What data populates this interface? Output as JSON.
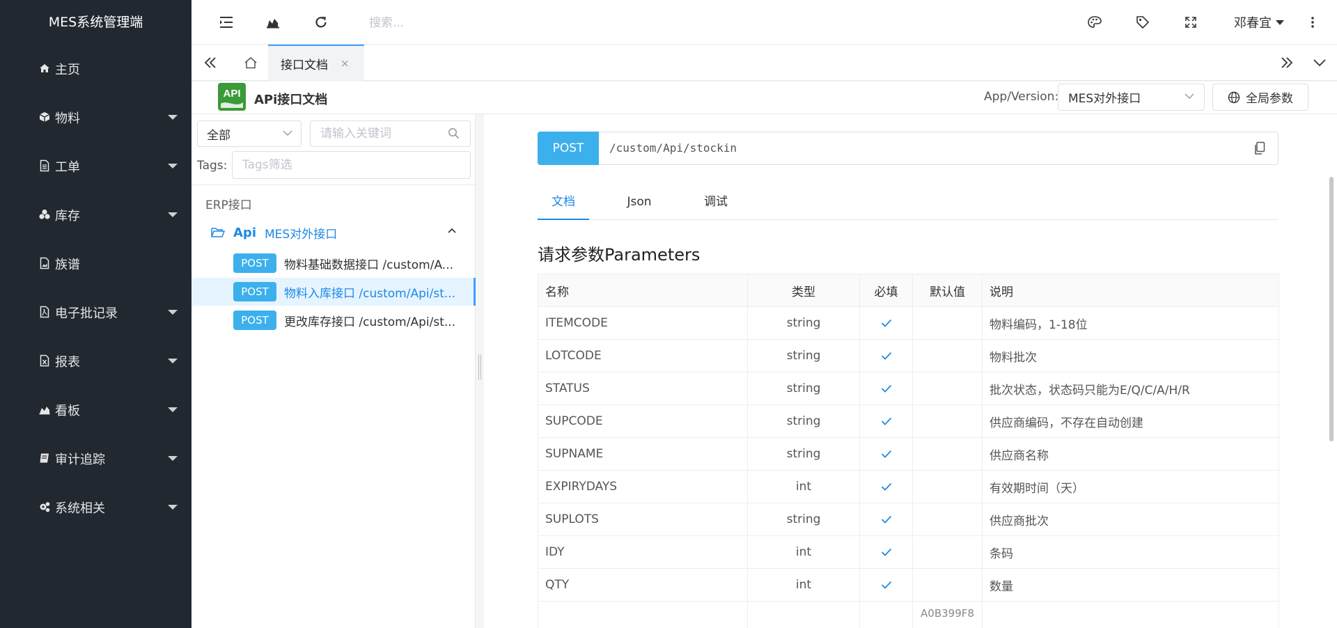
{
  "app": {
    "title": "MES系统管理端"
  },
  "sidebar": {
    "items": [
      {
        "label": "主页",
        "icon": "home-icon",
        "has_submenu": false
      },
      {
        "label": "物料",
        "icon": "cube-icon",
        "has_submenu": true
      },
      {
        "label": "工单",
        "icon": "file-text-icon",
        "has_submenu": true
      },
      {
        "label": "库存",
        "icon": "cubes-icon",
        "has_submenu": true
      },
      {
        "label": "族谱",
        "icon": "file-image-icon",
        "has_submenu": false
      },
      {
        "label": "电子批记录",
        "icon": "file-pdf-icon",
        "has_submenu": true
      },
      {
        "label": "报表",
        "icon": "file-excel-icon",
        "has_submenu": true
      },
      {
        "label": "看板",
        "icon": "area-chart-icon",
        "has_submenu": true
      },
      {
        "label": "审计追踪",
        "icon": "book-icon",
        "has_submenu": true
      },
      {
        "label": "系统相关",
        "icon": "cogs-icon",
        "has_submenu": true
      }
    ]
  },
  "topbar": {
    "search_placeholder": "搜索...",
    "user_name": "邓春宜"
  },
  "tabs": {
    "active_tab": "接口文档",
    "close_glyph": "×"
  },
  "doc_header": {
    "logo_text": "API",
    "title": "APi接口文档",
    "app_version_label": "App/Version:",
    "app_version_value": "MES对外接口",
    "global_params_label": "全局参数"
  },
  "left_panel": {
    "group_filter": "全部",
    "keyword_placeholder": "请输入关键词",
    "tags_label": "Tags:",
    "tags_placeholder": "Tags筛选",
    "tree_root": "ERP接口",
    "group_name": "Api",
    "group_desc": "MES对外接口",
    "apis": [
      {
        "method": "POST",
        "label": "物料基础数据接口  /custom/A...",
        "active": false
      },
      {
        "method": "POST",
        "label": "物料入库接口  /custom/Api/st...",
        "active": true
      },
      {
        "method": "POST",
        "label": "更改库存接口  /custom/Api/st...",
        "active": false
      }
    ]
  },
  "endpoint": {
    "method": "POST",
    "path": "/custom/Api/stockin"
  },
  "doc_tabs": [
    {
      "label": "文档",
      "active": true
    },
    {
      "label": "Json",
      "active": false
    },
    {
      "label": "调试",
      "active": false
    }
  ],
  "params": {
    "heading": "请求参数Parameters",
    "headers": {
      "name": "名称",
      "type": "类型",
      "required": "必填",
      "default": "默认值",
      "desc": "说明"
    },
    "rows": [
      {
        "name": "ITEMCODE",
        "type": "string",
        "required": true,
        "default": "",
        "desc": "物料编码，1-18位"
      },
      {
        "name": "LOTCODE",
        "type": "string",
        "required": true,
        "default": "",
        "desc": "物料批次"
      },
      {
        "name": "STATUS",
        "type": "string",
        "required": true,
        "default": "",
        "desc": "批次状态，状态码只能为E/Q/C/A/H/R"
      },
      {
        "name": "SUPCODE",
        "type": "string",
        "required": true,
        "default": "",
        "desc": "供应商编码，不存在自动创建"
      },
      {
        "name": "SUPNAME",
        "type": "string",
        "required": true,
        "default": "",
        "desc": "供应商名称"
      },
      {
        "name": "EXPIRYDAYS",
        "type": "int",
        "required": true,
        "default": "",
        "desc": "有效期时间（天）"
      },
      {
        "name": "SUPLOTS",
        "type": "string",
        "required": true,
        "default": "",
        "desc": "供应商批次"
      },
      {
        "name": "IDY",
        "type": "int",
        "required": true,
        "default": "",
        "desc": "条码"
      },
      {
        "name": "QTY",
        "type": "int",
        "required": true,
        "default": "",
        "desc": "数量"
      }
    ],
    "partial_row_default": "A0B399F8"
  },
  "colors": {
    "sidebar_bg": "#212830",
    "accent": "#1e88e5",
    "post_badge": "#3cb0ec"
  }
}
